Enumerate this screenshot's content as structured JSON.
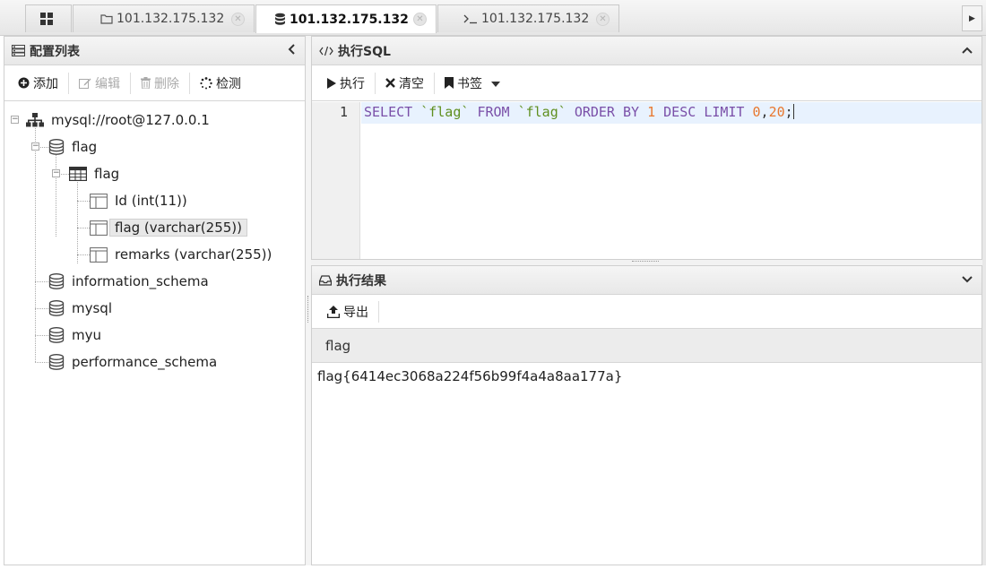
{
  "tabs": [
    {
      "label": "",
      "icon": "grid-icon"
    },
    {
      "label": "101.132.175.132",
      "icon": "folder-icon"
    },
    {
      "label": "101.132.175.132",
      "icon": "database-icon",
      "active": true
    },
    {
      "label": "101.132.175.132",
      "icon": "terminal-icon"
    }
  ],
  "tab_close_glyph": "✕",
  "left": {
    "title": "配置列表",
    "toolbar": {
      "add": "添加",
      "edit": "编辑",
      "delete": "删除",
      "test": "检测"
    },
    "tree": {
      "root": "mysql://root@127.0.0.1",
      "db_flag": "flag",
      "table_flag": "flag",
      "col_id": "Id (int(11))",
      "col_flag": "flag (varchar(255))",
      "col_remarks": "remarks (varchar(255))",
      "db_info": "information_schema",
      "db_mysql": "mysql",
      "db_myu": "myu",
      "db_perf": "performance_schema"
    }
  },
  "sql_panel": {
    "title": "执行SQL",
    "toolbar": {
      "run": "执行",
      "clear": "清空",
      "bookmark": "书签"
    },
    "editor": {
      "line_number": "1",
      "tokens": {
        "select": "SELECT",
        "col": "`flag`",
        "from": "FROM",
        "table": "`flag`",
        "orderby": "ORDER BY",
        "one": "1",
        "desc": "DESC",
        "limit": "LIMIT",
        "zero": "0",
        "comma": ",",
        "twenty": "20",
        "semi": ";"
      }
    }
  },
  "result_panel": {
    "title": "执行结果",
    "toolbar": {
      "export": "导出"
    },
    "columns": [
      "flag"
    ],
    "rows": [
      [
        "flag{6414ec3068a224f56b99f4a4a8aa177a}"
      ]
    ]
  }
}
